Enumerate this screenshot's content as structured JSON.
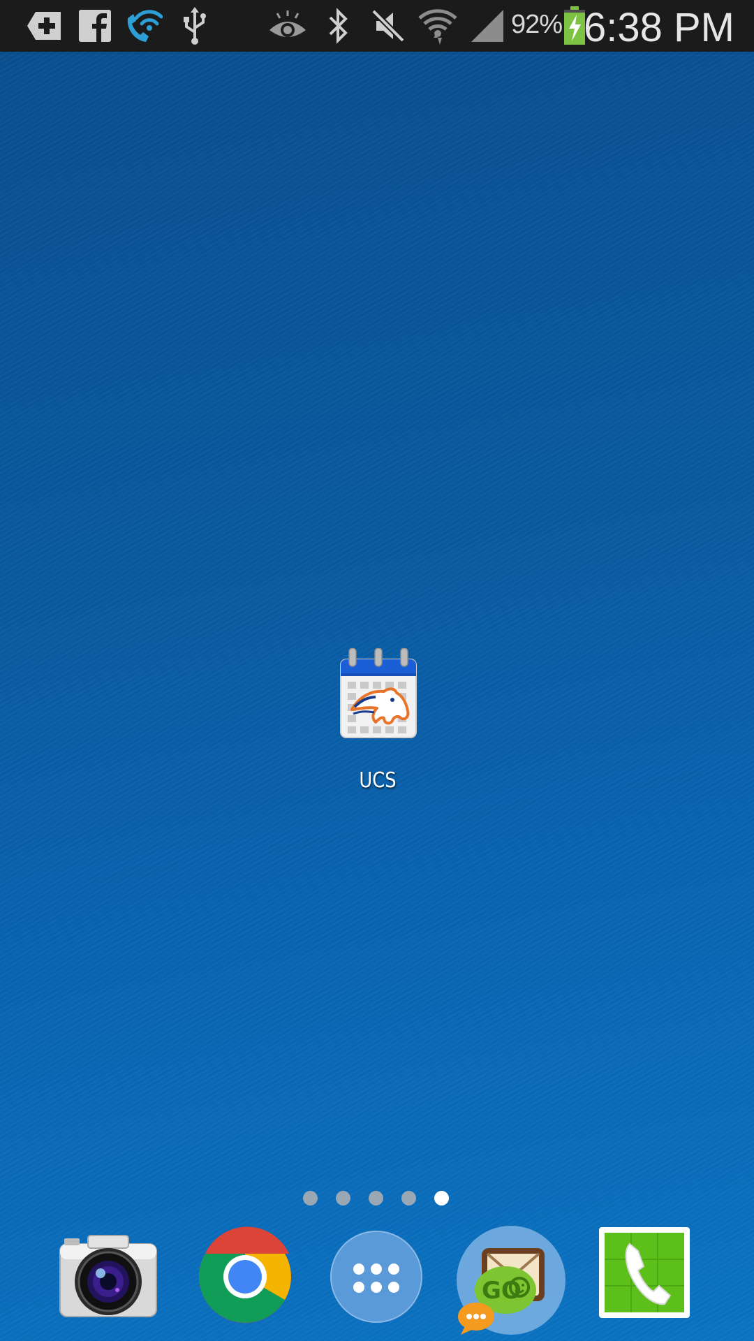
{
  "status_bar": {
    "icons": [
      "add-notification-icon",
      "facebook-icon",
      "wifi-calling-icon",
      "usb-icon",
      "smart-stay-eye-icon",
      "bluetooth-icon",
      "sound-muted-icon",
      "wifi-signal-icon",
      "cellular-signal-icon",
      "battery-charging-icon"
    ],
    "battery_percent": "92%",
    "time": "6:38 PM"
  },
  "home": {
    "app": {
      "label": "UCS",
      "icon": "ucs-calendar-mustang-icon"
    },
    "page_indicator": {
      "total": 5,
      "active_index": 4
    }
  },
  "dock": [
    {
      "name": "Camera",
      "icon": "camera-icon"
    },
    {
      "name": "Chrome",
      "icon": "chrome-icon"
    },
    {
      "name": "Apps",
      "icon": "apps-grid-icon"
    },
    {
      "name": "GO SMS",
      "icon": "go-sms-icon"
    },
    {
      "name": "Phone",
      "icon": "phone-icon"
    }
  ],
  "colors": {
    "wallpaper_top": "#0a4f8e",
    "wallpaper_bottom": "#0b74c4",
    "status_bar_bg": "#1b1b1b",
    "battery_green": "#7dc242",
    "phone_green": "#5cbf1a"
  }
}
